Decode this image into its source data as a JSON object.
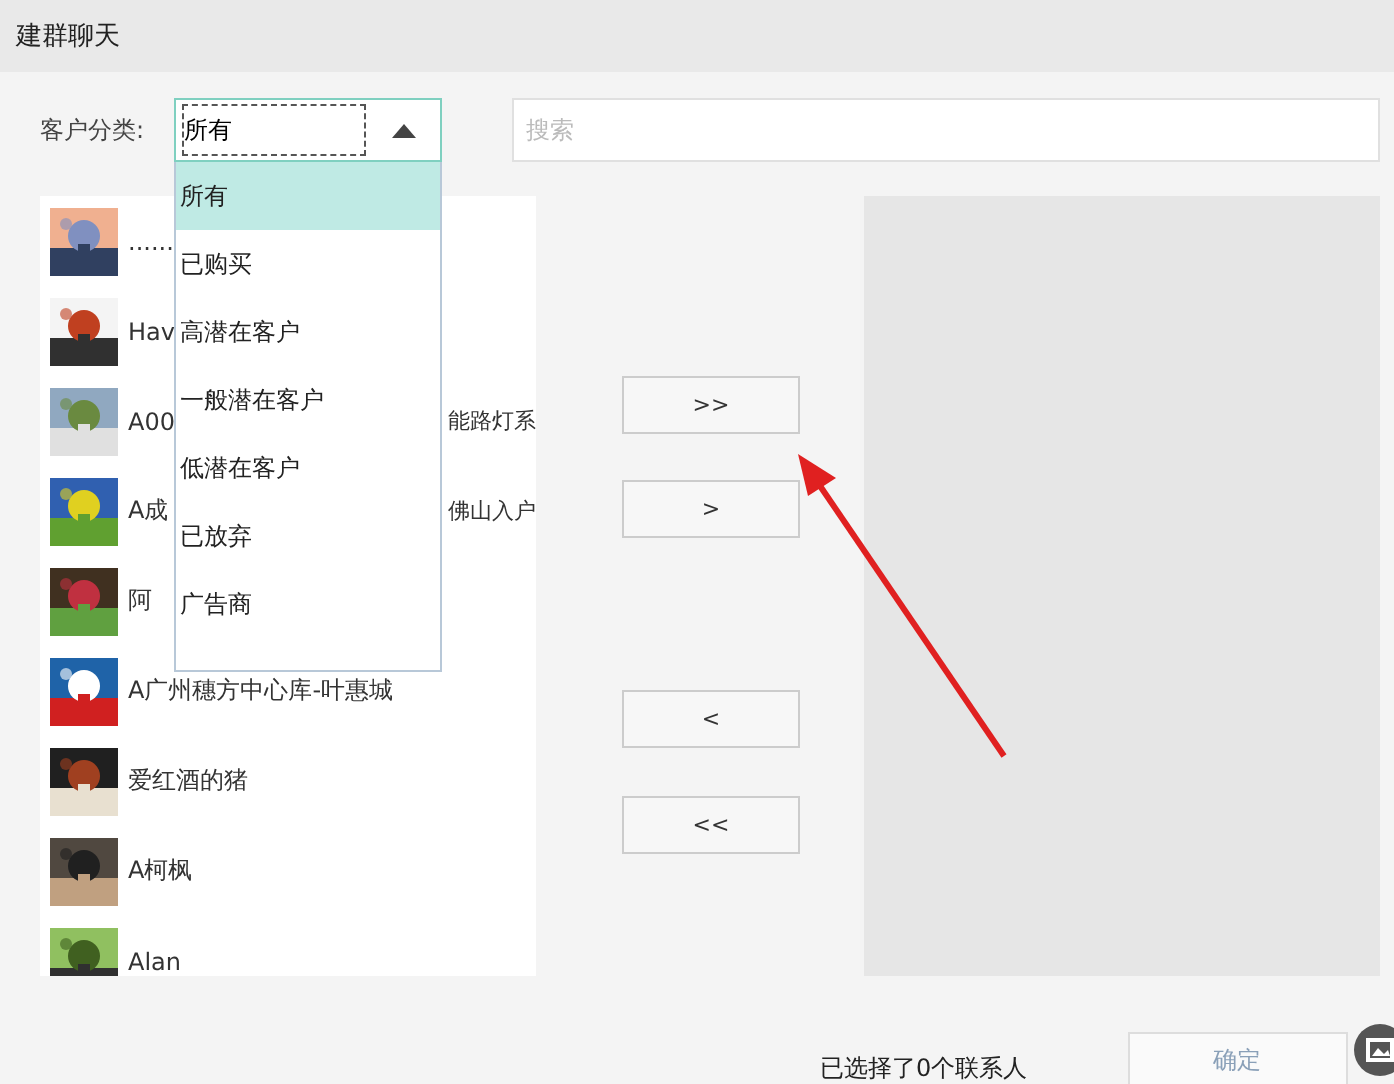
{
  "window": {
    "title": "建群聊天"
  },
  "filter": {
    "label": "客户分类:",
    "value": "所有",
    "expanded": true,
    "options": [
      {
        "label": "所有",
        "selected": true
      },
      {
        "label": "已购买",
        "selected": false
      },
      {
        "label": "高潜在客户",
        "selected": false
      },
      {
        "label": "一般潜在客户",
        "selected": false
      },
      {
        "label": "低潜在客户",
        "selected": false
      },
      {
        "label": "已放弃",
        "selected": false
      },
      {
        "label": "广告商",
        "selected": false
      }
    ]
  },
  "search": {
    "placeholder": "搜索"
  },
  "contacts": [
    {
      "name": "......"
    },
    {
      "name": "Hav"
    },
    {
      "name": "A00",
      "name_tail": "能路灯系"
    },
    {
      "name": "A成",
      "name_tail": "佛山入户"
    },
    {
      "name": "阿"
    },
    {
      "name": "A广州穗方中心库-叶惠城"
    },
    {
      "name": "爱红酒的猪"
    },
    {
      "name": "A柯枫"
    },
    {
      "name": "Alan"
    }
  ],
  "move_buttons": [
    ">>",
    ">",
    "<",
    "<<"
  ],
  "status": "已选择了0个联系人",
  "confirm_button": "确定"
}
